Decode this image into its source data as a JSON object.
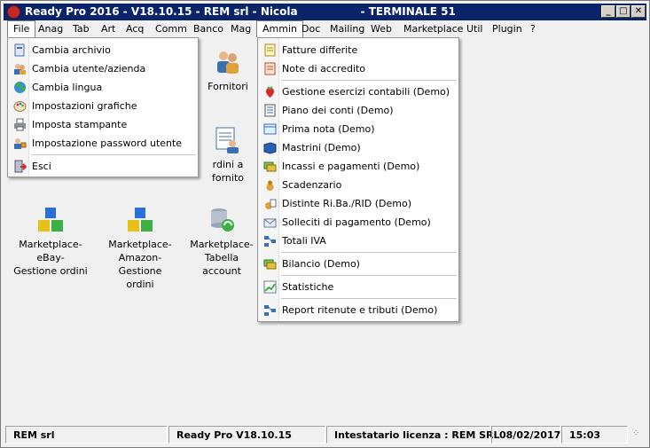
{
  "window": {
    "title": "Ready Pro 2016 - V18.10.15 - REM srl - Nicola                 - TERMINALE 51",
    "minimize_glyph": "_",
    "maximize_glyph": "□",
    "close_glyph": "✕"
  },
  "menubar": {
    "items": [
      "File",
      "Anag",
      "Tab",
      "Art",
      "Acq",
      "Comm",
      "Banco",
      "Mag",
      "Ammin",
      "Doc",
      "Mailing",
      "Web",
      "Marketplace",
      "Util",
      "Plugin",
      "?"
    ]
  },
  "file_menu": {
    "items": [
      {
        "label": "Cambia archivio",
        "icon": "archive-icon"
      },
      {
        "label": "Cambia utente/azienda",
        "icon": "users-icon"
      },
      {
        "label": "Cambia lingua",
        "icon": "globe-icon"
      },
      {
        "label": "Impostazioni grafiche",
        "icon": "palette-icon"
      },
      {
        "label": "Imposta stampante",
        "icon": "printer-icon"
      },
      {
        "label": "Impostazione password utente",
        "icon": "password-icon"
      },
      {
        "label": "Esci",
        "icon": "exit-icon"
      }
    ]
  },
  "ammin_menu": {
    "items": [
      {
        "label": "Fatture differite",
        "icon": "invoice-icon"
      },
      {
        "label": "Note di accredito",
        "icon": "credit-note-icon"
      },
      {
        "label": "Gestione esercizi contabili (Demo)",
        "icon": "strawberry-icon"
      },
      {
        "label": "Piano dei conti (Demo)",
        "icon": "chart-of-accounts-icon"
      },
      {
        "label": "Prima nota (Demo)",
        "icon": "journal-icon"
      },
      {
        "label": "Mastrini (Demo)",
        "icon": "ledger-book-icon"
      },
      {
        "label": "Incassi e pagamenti (Demo)",
        "icon": "payments-icon"
      },
      {
        "label": "Scadenzario",
        "icon": "deadlines-icon"
      },
      {
        "label": "Distinte Ri.Ba./RID (Demo)",
        "icon": "riba-icon"
      },
      {
        "label": "Solleciti di pagamento (Demo)",
        "icon": "reminder-icon"
      },
      {
        "label": "Totali IVA",
        "icon": "vat-totals-icon"
      },
      {
        "label": "Bilancio (Demo)",
        "icon": "balance-icon"
      },
      {
        "label": "Statistiche",
        "icon": "statistics-icon"
      },
      {
        "label": "Report ritenute e tributi (Demo)",
        "icon": "report-icon"
      }
    ]
  },
  "desktop": {
    "fornitori": "Fornitori",
    "ordini_fornitori": "rdini a fornito",
    "ebay": [
      "Marketplace- eBay-",
      "Gestione ordini"
    ],
    "amazon": [
      "Marketplace-",
      "Amazon- Gestione",
      "ordini"
    ],
    "tabella": [
      "Marketplace-",
      "Tabella account"
    ]
  },
  "statusbar": {
    "company": "REM srl",
    "version": "Ready Pro V18.10.15",
    "license": "Intestatario licenza : REM SRL",
    "date": "08/02/2017",
    "time": "15:03",
    "grip": "⁘"
  },
  "colors": {
    "titlebar": "#0a246a",
    "menu_bg": "#ffffff",
    "window_bg": "#f0f0f0"
  }
}
